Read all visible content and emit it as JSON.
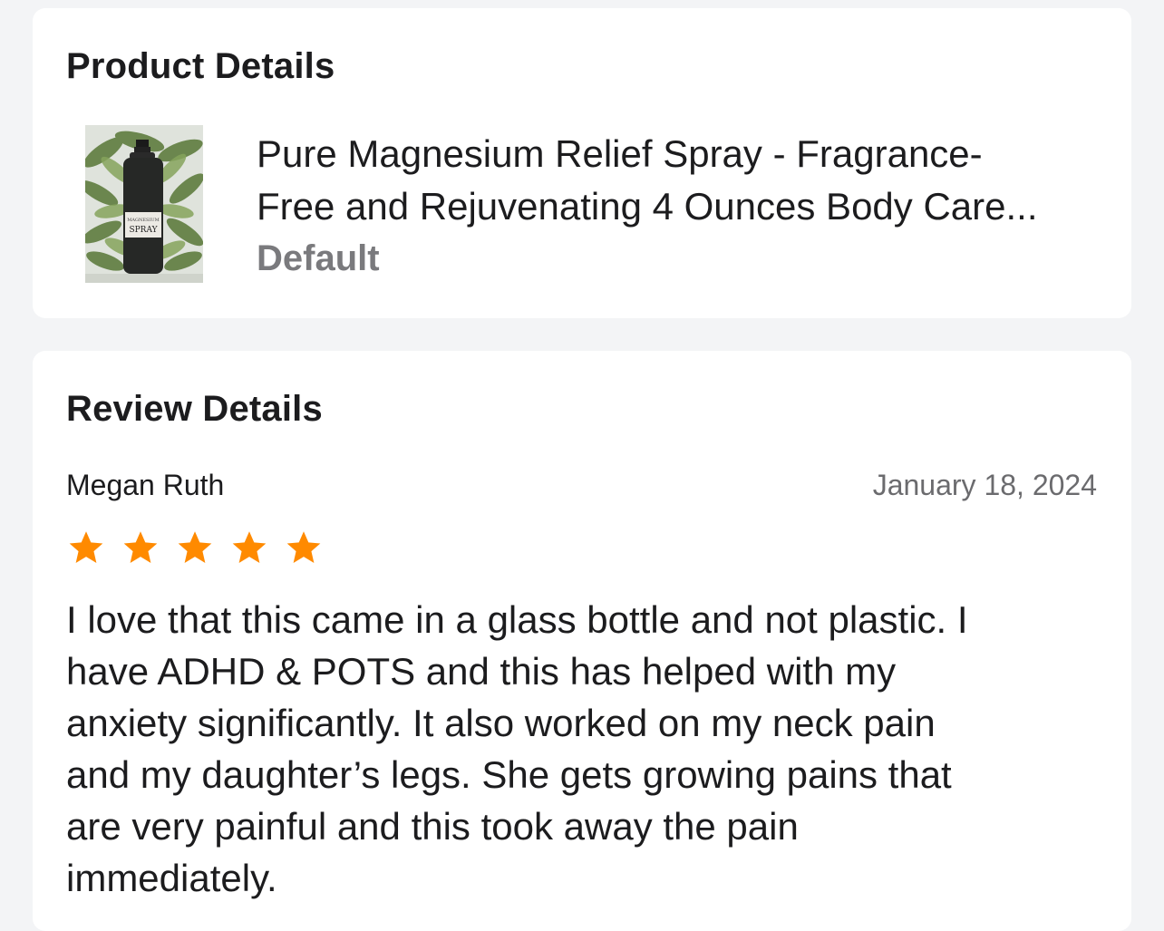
{
  "product_details": {
    "title": "Product Details",
    "image_icon": "product-photo",
    "bottle_label_top": "MAGNESIUM",
    "bottle_label": "SPRAY",
    "product_name_lines": [
      "Pure Magnesium Relief Spray - Fragrance-",
      "Free and Rejuvenating 4 Ounces Body Care..."
    ],
    "variant": "Default"
  },
  "review_details": {
    "title": "Review Details",
    "reviewer": "Megan Ruth",
    "date": "January 18, 2024",
    "rating": 5,
    "rating_max": 5,
    "star_color": "#ff8a00",
    "text_lines": [
      "I love that this came in a glass bottle and not plastic. I",
      "have ADHD & POTS and this has helped with my",
      "anxiety significantly. It also worked on my neck pain",
      "and my daughter’s legs. She gets growing pains that",
      "are very painful and this took away the pain",
      "immediately."
    ]
  }
}
